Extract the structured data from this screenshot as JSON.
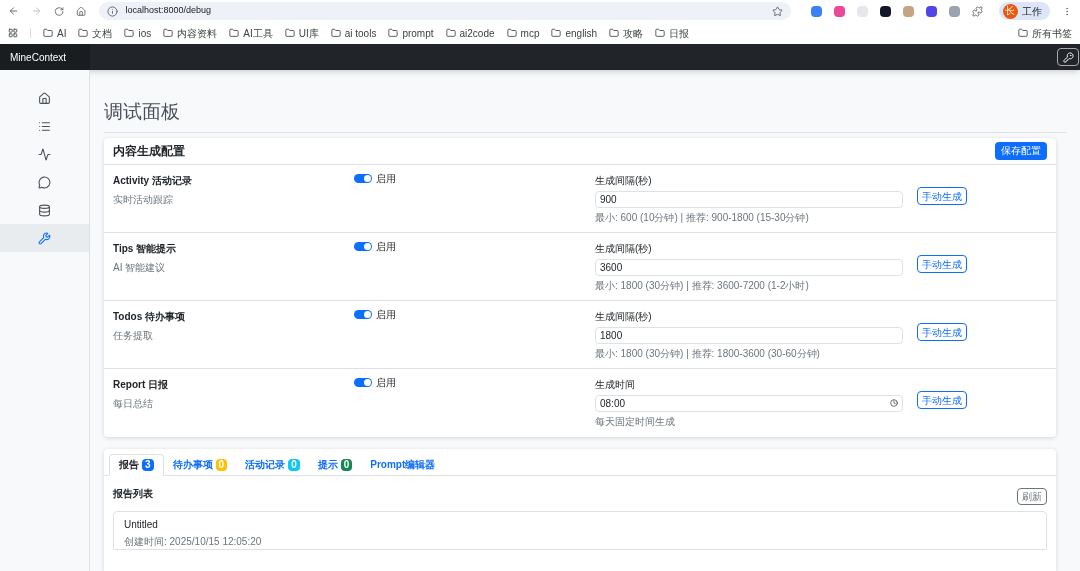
{
  "browser": {
    "url": "localhost:8000/debug",
    "bookmarks": [
      "AI",
      "文档",
      "ios",
      "内容资料",
      "AI工具",
      "UI库",
      "ai tools",
      "prompt",
      "ai2code",
      "mcp",
      "english",
      "攻略",
      "日报"
    ],
    "all_bookmarks": "所有书签",
    "profile": {
      "initial": "长",
      "label": "工作"
    }
  },
  "app": {
    "brand": "MineContext",
    "sidebar": [
      {
        "selected": false
      },
      {
        "selected": false
      },
      {
        "selected": false
      },
      {
        "selected": false
      },
      {
        "selected": false
      },
      {
        "selected": true
      }
    ]
  },
  "page": {
    "title": "调试面板"
  },
  "config": {
    "title": "内容生成配置",
    "save": "保存配置",
    "rows": [
      {
        "name": "Activity 活动记录",
        "desc": "实时活动跟踪",
        "enabled": true,
        "toggle_label": "启用",
        "field_label": "生成间隔(秒)",
        "kind": "number",
        "value": "900",
        "hint": "最小: 600 (10分钟) | 推荐: 900-1800 (15-30分钟)",
        "action": "手动生成"
      },
      {
        "name": "Tips 智能提示",
        "desc": "AI 智能建议",
        "enabled": true,
        "toggle_label": "启用",
        "field_label": "生成间隔(秒)",
        "kind": "number",
        "value": "3600",
        "hint": "最小: 1800 (30分钟) | 推荐: 3600-7200 (1-2小时)",
        "action": "手动生成"
      },
      {
        "name": "Todos 待办事项",
        "desc": "任务提取",
        "enabled": true,
        "toggle_label": "启用",
        "field_label": "生成间隔(秒)",
        "kind": "number",
        "value": "1800",
        "hint": "最小: 1800 (30分钟) | 推荐: 1800-3600 (30-60分钟)",
        "action": "手动生成"
      },
      {
        "name": "Report 日报",
        "desc": "每日总结",
        "enabled": true,
        "toggle_label": "启用",
        "field_label": "生成时间",
        "kind": "time",
        "value": "08:00",
        "hint": "每天固定时间生成",
        "action": "手动生成"
      }
    ]
  },
  "tabs": [
    {
      "label": "报告",
      "count": "3",
      "color": "#0d6efd",
      "selected": true
    },
    {
      "label": "待办事项",
      "count": "0",
      "color": "#ffc107",
      "selected": false
    },
    {
      "label": "活动记录",
      "count": "0",
      "color": "#0dcaf0",
      "selected": false
    },
    {
      "label": "提示",
      "count": "0",
      "color": "#198754",
      "selected": false
    },
    {
      "label": "Prompt编辑器",
      "selected": false
    }
  ],
  "reports": {
    "title": "报告列表",
    "refresh": "刷新",
    "items": [
      {
        "title": "Untitled",
        "created": "创建时间: 2025/10/15 12:05:20"
      }
    ]
  }
}
